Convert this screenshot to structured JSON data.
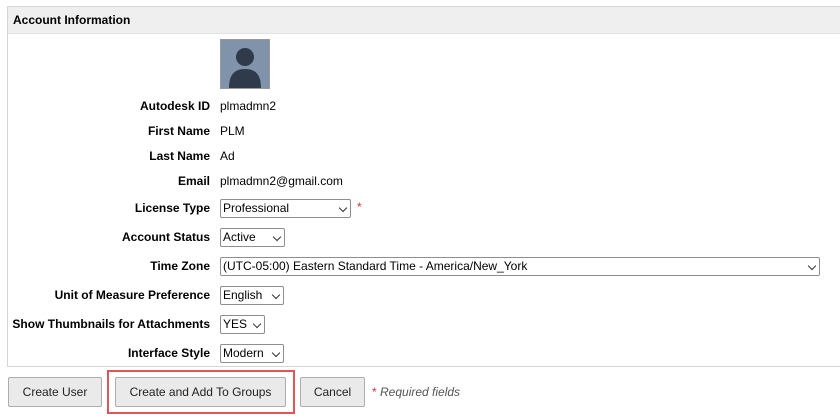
{
  "section": {
    "title": "Account Information"
  },
  "fields": {
    "autodesk_id": {
      "label": "Autodesk ID",
      "value": "plmadmn2"
    },
    "first_name": {
      "label": "First Name",
      "value": "PLM"
    },
    "last_name": {
      "label": "Last Name",
      "value": "Ad"
    },
    "email": {
      "label": "Email",
      "value": "plmadmn2@gmail.com"
    },
    "license_type": {
      "label": "License Type",
      "value": "Professional",
      "required_marker": "*"
    },
    "account_status": {
      "label": "Account Status",
      "value": "Active"
    },
    "time_zone": {
      "label": "Time Zone",
      "value": "(UTC-05:00) Eastern Standard Time - America/New_York"
    },
    "unit_of_measure": {
      "label": "Unit of Measure Preference",
      "value": "English"
    },
    "show_thumbnails": {
      "label": "Show Thumbnails for Attachments",
      "value": "YES"
    },
    "interface_style": {
      "label": "Interface Style",
      "value": "Modern"
    }
  },
  "actions": {
    "create_user": "Create User",
    "create_and_add": "Create and Add To Groups",
    "cancel": "Cancel"
  },
  "required_note": {
    "star": "*",
    "text": "Required fields"
  },
  "icons": {
    "avatar": "user-avatar-icon",
    "dropdown": "chevron-down-icon"
  },
  "colors": {
    "required": "#e0312f",
    "highlight": "#e05656",
    "header_bg": "#efefef"
  }
}
